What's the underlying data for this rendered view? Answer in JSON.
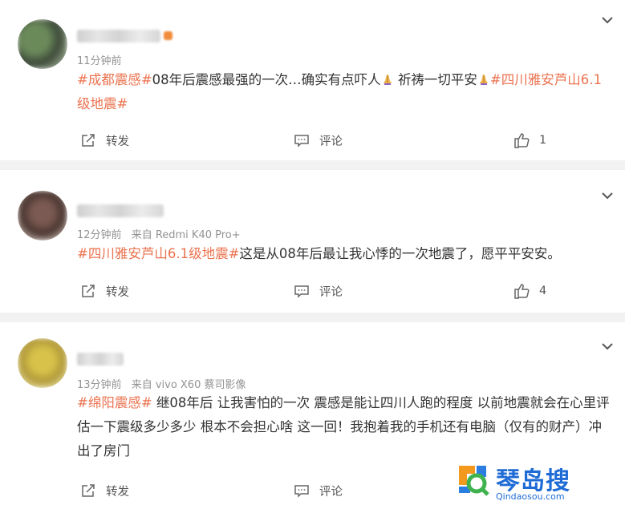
{
  "posts": [
    {
      "time": "11分钟前",
      "source": "",
      "content": [
        {
          "t": "tag",
          "v": "#成都震感#"
        },
        {
          "t": "text",
          "v": "08年后震感最强的一次…确实有点吓人"
        },
        {
          "t": "emoji",
          "v": "pray"
        },
        {
          "t": "text",
          "v": " 祈祷一切平安"
        },
        {
          "t": "emoji",
          "v": "pray"
        },
        {
          "t": "tag",
          "v": "#四川雅安芦山6.1级地震#"
        }
      ],
      "repost_label": "转发",
      "comment_label": "评论",
      "like_count": "1"
    },
    {
      "time": "12分钟前",
      "source": "来自 Redmi K40 Pro+",
      "content": [
        {
          "t": "tag",
          "v": "#四川雅安芦山6.1级地震#"
        },
        {
          "t": "text",
          "v": "这是从08年后最让我心悸的一次地震了，愿平平安安。"
        }
      ],
      "repost_label": "转发",
      "comment_label": "评论",
      "like_count": "4"
    },
    {
      "time": "13分钟前",
      "source": "来自 vivo X60 蔡司影像",
      "content": [
        {
          "t": "tag",
          "v": "#绵阳震感#"
        },
        {
          "t": "text",
          "v": " 继08年后 让我害怕的一次 震感是能让四川人跑的程度 以前地震就会在心里评估一下震级多少多少 根本不会担心啥 这一回！我抱着我的手机还有电脑（仅有的财产）冲出了房门"
        }
      ],
      "repost_label": "转发",
      "comment_label": "评论",
      "like_count": ""
    }
  ],
  "watermark": {
    "brand": "琴岛搜",
    "url": "Qindaosou.com"
  },
  "icons": {
    "repost": "repost-icon",
    "comment": "comment-icon",
    "like": "thumbs-up-icon",
    "more": "chevron-down-icon"
  },
  "colors": {
    "tag": "#eb7350",
    "meta": "#939393",
    "divider": "#f2f2f2",
    "watermark": "#1e6bd6"
  }
}
